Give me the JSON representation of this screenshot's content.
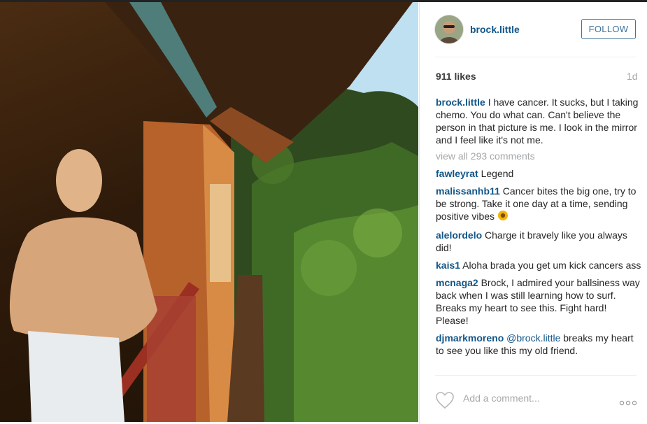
{
  "post": {
    "username": "brock.little",
    "follow_label": "FOLLOW",
    "likes": "911 likes",
    "time": "1d",
    "caption": {
      "user": "brock.little",
      "text": "I have cancer. It sucks, but I taking chemo. You do what can. Can't believe the person in that picture is me. I look in the mirror and I feel like it's not me."
    },
    "view_all": "view all 293 comments",
    "comments": [
      {
        "user": "fawleyrat",
        "text": "Legend"
      },
      {
        "user": "malissanhb11",
        "text": "Cancer bites the big one, try to be strong. Take it one day at a time, sending positive vibes"
      },
      {
        "user": "alelordelo",
        "text": "Charge it bravely like you always did!"
      },
      {
        "user": "kais1",
        "text": "Aloha brada you get um kick cancers ass"
      },
      {
        "user": "mcnaga2",
        "text": "Brock, I admired your ballsiness way back when I was still learning how to surf. Breaks my heart to see this. Fight hard! Please!"
      },
      {
        "user": "djmarkmoreno",
        "mention": "@brock.little",
        "text": "breaks my heart to see you like this my old friend."
      }
    ],
    "add_comment_placeholder": "Add a comment...",
    "icons": {
      "like": "heart-icon",
      "more": "more-options-icon",
      "emoji": "sunflower-emoji"
    }
  },
  "colors": {
    "link": "#125688",
    "follow": "#3f729b",
    "muted": "#a5a7aa"
  }
}
